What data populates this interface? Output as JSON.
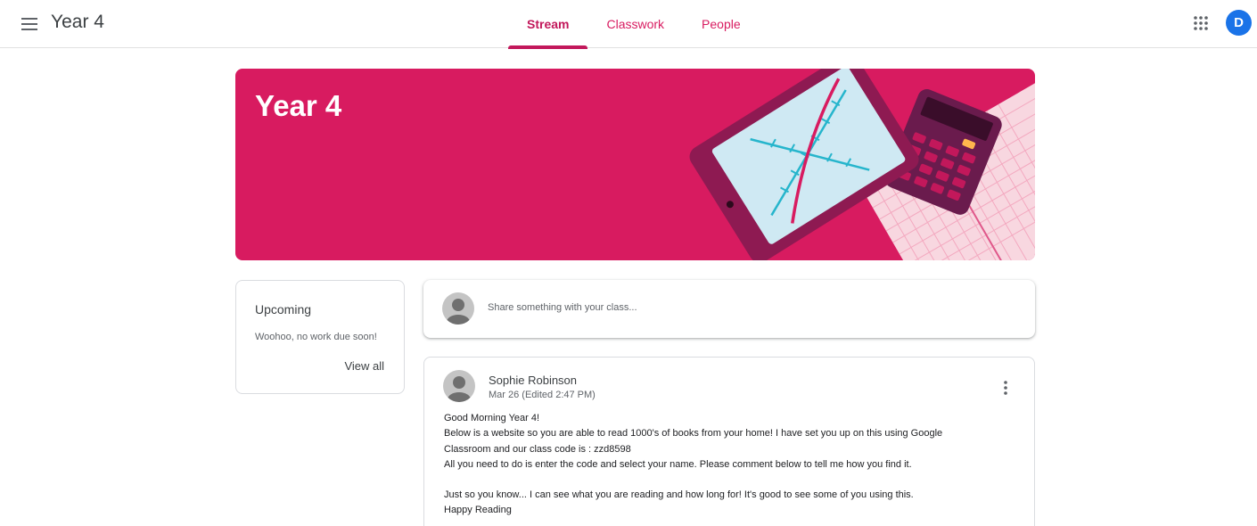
{
  "header": {
    "class_title": "Year 4",
    "tabs": [
      {
        "label": "Stream",
        "active": true
      },
      {
        "label": "Classwork",
        "active": false
      },
      {
        "label": "People",
        "active": false
      }
    ],
    "account_initial": "D",
    "icons": {
      "menu": "hamburger-menu-icon",
      "apps": "google-apps-grid-icon"
    }
  },
  "banner": {
    "title": "Year 4",
    "color": "#d81b60",
    "illustration": "tablet-graph-calculator-paper"
  },
  "upcoming": {
    "title": "Upcoming",
    "message": "Woohoo, no work due soon!",
    "view_all_label": "View all"
  },
  "share": {
    "placeholder": "Share something with your class..."
  },
  "post": {
    "author": "Sophie Robinson",
    "date": "Mar 26 (Edited 2:47 PM)",
    "lines": [
      "Good Morning Year 4!",
      "Below is a website so you are able to read 1000's of books from your home! I have set you up on this using Google",
      "Classroom and our class code is : zzd8598",
      "All you need to do is enter the code and select your name. Please comment below to tell me how you find it.",
      "",
      "Just so you know... I can see what you are reading and how long for! It's good to see some of you using this.",
      "Happy Reading"
    ]
  },
  "colors": {
    "accent": "#c2185b",
    "tab_text": "#d81b60",
    "account_avatar": "#1a73e8",
    "placeholder_avatar": "#c4c4c4"
  }
}
